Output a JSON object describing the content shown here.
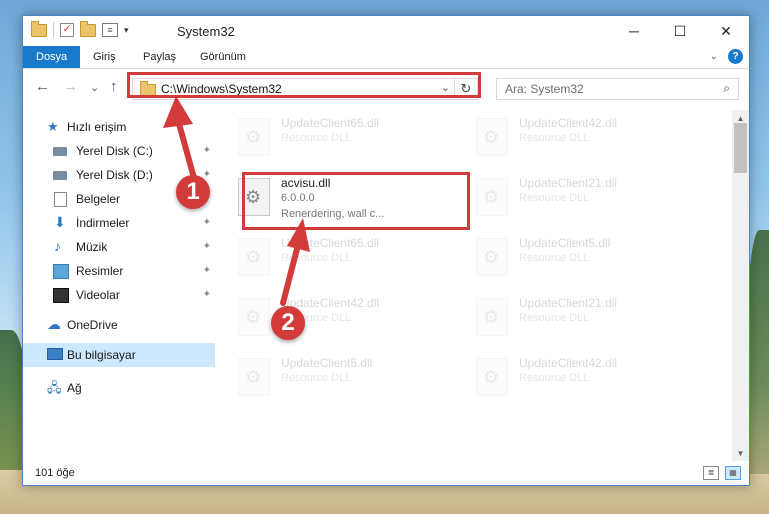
{
  "window": {
    "title": "System32",
    "controls": {
      "minimize": "─",
      "maximize": "☐",
      "close": "✕"
    }
  },
  "ribbon": {
    "tabs": [
      "Dosya",
      "Giriş",
      "Paylaş",
      "Görünüm"
    ],
    "expand_glyph": "⌄",
    "help_glyph": "?"
  },
  "nav": {
    "back": "←",
    "forward": "→",
    "recent": "⌄",
    "up": "↑",
    "address": "C:\\Windows\\System32",
    "address_dropdown": "⌄",
    "refresh": "↻",
    "search_placeholder": "Ara: System32",
    "search_icon": "⌕"
  },
  "sidebar": {
    "items": [
      {
        "label": "Hızlı erişim",
        "icon": "star-icon",
        "pinned": false
      },
      {
        "label": "Yerel Disk (C:)",
        "icon": "drive-icon",
        "pinned": true
      },
      {
        "label": "Yerel Disk (D:)",
        "icon": "drive-icon",
        "pinned": true
      },
      {
        "label": "Belgeler",
        "icon": "documents-icon",
        "pinned": true
      },
      {
        "label": "İndirmeler",
        "icon": "download-icon",
        "pinned": true
      },
      {
        "label": "Müzik",
        "icon": "music-icon",
        "pinned": true
      },
      {
        "label": "Resimler",
        "icon": "pictures-icon",
        "pinned": true
      },
      {
        "label": "Videolar",
        "icon": "videos-icon",
        "pinned": true
      },
      {
        "label": "OneDrive",
        "icon": "cloud-icon",
        "pinned": false
      },
      {
        "label": "Bu bilgisayar",
        "icon": "computer-icon",
        "pinned": false,
        "selected": true
      },
      {
        "label": "Ağ",
        "icon": "network-icon",
        "pinned": false
      }
    ],
    "pin_glyph": "📌"
  },
  "files": {
    "highlighted": {
      "name": "acvisu.dll",
      "version": "6.0.0.0",
      "description": "Renerdering, wall c..."
    },
    "faded": [
      {
        "name": "UpdateClient65.dll",
        "type": "Resource DLL"
      },
      {
        "name": "UpdateClient42.dll",
        "type": "Resource DLL"
      },
      {
        "name": "UpdateClient21.dll",
        "type": "Resource DLL"
      },
      {
        "name": "UpdateClient65.dll",
        "type": "Resource DLL"
      },
      {
        "name": "UpdateClient5.dll",
        "type": "Resource DLL"
      },
      {
        "name": "UpdateClient42.dll",
        "type": "Resource DLL"
      },
      {
        "name": "UpdateClient21.dll",
        "type": "Resource DLL"
      },
      {
        "name": "UpdateClient5.dll",
        "type": "Resource DLL"
      },
      {
        "name": "UpdateClient42.dll",
        "type": "Resource DLL"
      }
    ]
  },
  "status": {
    "item_count": "101 öğe"
  },
  "annotations": {
    "step1": "1",
    "step2": "2",
    "color": "#d33a3a"
  }
}
